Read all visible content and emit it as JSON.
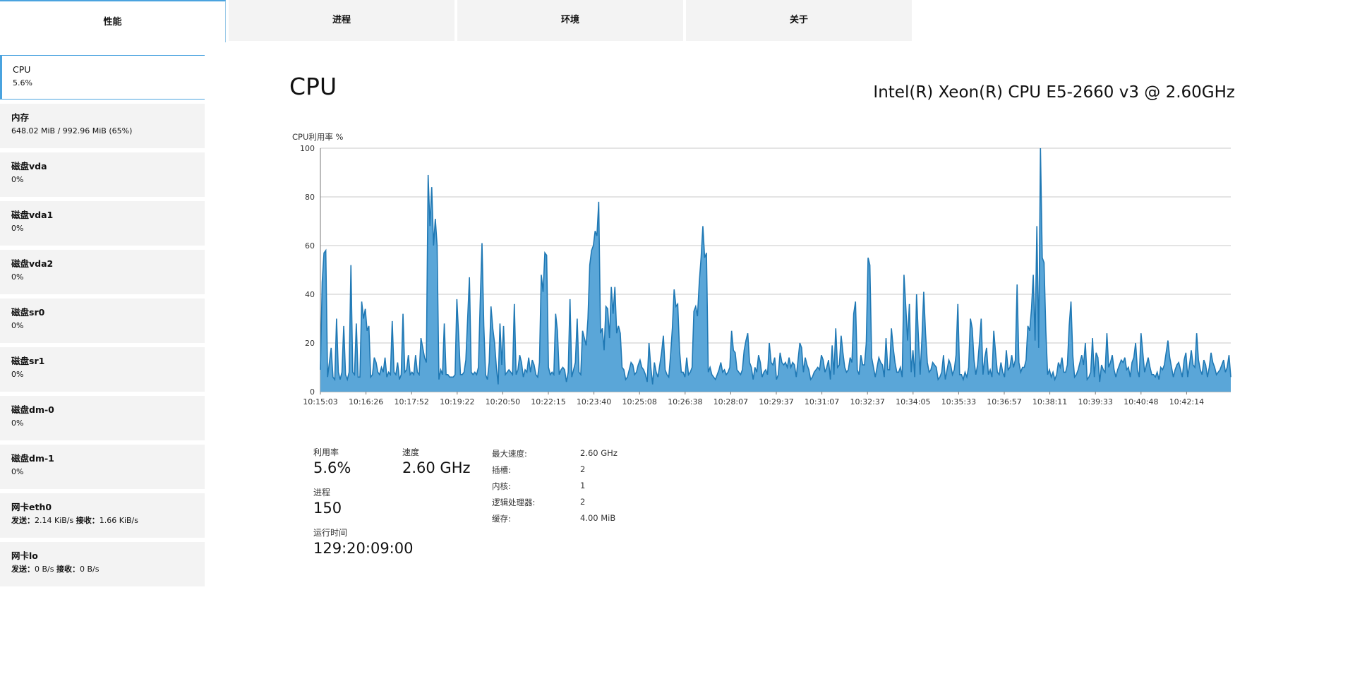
{
  "tabs": [
    {
      "label": "性能",
      "active": true
    },
    {
      "label": "进程",
      "active": false
    },
    {
      "label": "环境",
      "active": false
    },
    {
      "label": "关于",
      "active": false
    }
  ],
  "sidebar": {
    "items": [
      {
        "name": "CPU",
        "value": "5.6%",
        "active": true
      },
      {
        "name": "内存",
        "value": "648.02 MiB / 992.96 MiB (65%)"
      },
      {
        "name": "磁盘vda",
        "value": "0%"
      },
      {
        "name": "磁盘vda1",
        "value": "0%"
      },
      {
        "name": "磁盘vda2",
        "value": "0%"
      },
      {
        "name": "磁盘sr0",
        "value": "0%"
      },
      {
        "name": "磁盘sr1",
        "value": "0%"
      },
      {
        "name": "磁盘dm-0",
        "value": "0%"
      },
      {
        "name": "磁盘dm-1",
        "value": "0%"
      },
      {
        "name": "网卡eth0",
        "send_label": "发送：",
        "send": "2.14 KiB/s",
        "recv_label": "接收：",
        "recv": "1.66 KiB/s"
      },
      {
        "name": "网卡lo",
        "send_label": "发送：",
        "send": "0 B/s",
        "recv_label": "接收：",
        "recv": "0 B/s"
      }
    ]
  },
  "main": {
    "title": "CPU",
    "model": "Intel(R) Xeon(R) CPU E5-2660 v3 @ 2.60GHz"
  },
  "chart_data": {
    "type": "area",
    "ylabel": "CPU利用率 %",
    "ylim": [
      0,
      100
    ],
    "yticks": [
      0,
      20,
      40,
      60,
      80,
      100
    ],
    "xticks": [
      "10:15:03",
      "10:16:26",
      "10:17:52",
      "10:19:22",
      "10:20:50",
      "10:22:15",
      "10:23:40",
      "10:25:08",
      "10:26:38",
      "10:28:07",
      "10:29:37",
      "10:31:07",
      "10:32:37",
      "10:34:05",
      "10:35:33",
      "10:36:57",
      "10:38:11",
      "10:39:33",
      "10:40:48",
      "10:42:14"
    ],
    "color": "#1f78b4",
    "fill": "#5aa6d8",
    "values": [
      9,
      45,
      57,
      58,
      6,
      12,
      18,
      6,
      5,
      30,
      8,
      5,
      8,
      27,
      7,
      5,
      8,
      52,
      8,
      7,
      28,
      6,
      6,
      37,
      30,
      34,
      25,
      27,
      6,
      7,
      14,
      12,
      8,
      7,
      10,
      8,
      14,
      6,
      8,
      7,
      29,
      8,
      7,
      12,
      5,
      7,
      32,
      8,
      9,
      15,
      7,
      8,
      7,
      15,
      8,
      7,
      22,
      18,
      14,
      12,
      89,
      68,
      84,
      60,
      71,
      60,
      5,
      9,
      7,
      28,
      7,
      7,
      6,
      6,
      6,
      7,
      38,
      23,
      7,
      7,
      8,
      13,
      30,
      47,
      8,
      7,
      8,
      7,
      10,
      37,
      61,
      27,
      7,
      5,
      12,
      35,
      26,
      20,
      10,
      3,
      28,
      11,
      27,
      7,
      8,
      9,
      8,
      7,
      36,
      7,
      9,
      15,
      12,
      6,
      9,
      8,
      14,
      8,
      13,
      11,
      7,
      6,
      12,
      48,
      41,
      57,
      56,
      10,
      7,
      8,
      7,
      32,
      25,
      7,
      9,
      10,
      9,
      4,
      8,
      38,
      6,
      9,
      12,
      30,
      8,
      7,
      25,
      22,
      19,
      30,
      52,
      58,
      60,
      66,
      64,
      78,
      24,
      26,
      17,
      35,
      34,
      22,
      43,
      32,
      43,
      24,
      27,
      24,
      10,
      9,
      5,
      6,
      9,
      12,
      11,
      7,
      8,
      11,
      13,
      10,
      9,
      7,
      4,
      20,
      10,
      3,
      12,
      8,
      6,
      11,
      16,
      23,
      9,
      7,
      6,
      15,
      26,
      42,
      35,
      36,
      17,
      8,
      8,
      6,
      14,
      7,
      8,
      10,
      33,
      35,
      31,
      45,
      55,
      68,
      55,
      57,
      8,
      10,
      7,
      6,
      5,
      7,
      9,
      12,
      8,
      9,
      7,
      8,
      10,
      25,
      17,
      16,
      9,
      8,
      7,
      9,
      17,
      21,
      24,
      12,
      10,
      5,
      10,
      8,
      15,
      12,
      6,
      8,
      9,
      7,
      20,
      12,
      11,
      14,
      5,
      7,
      16,
      12,
      11,
      12,
      10,
      14,
      10,
      12,
      11,
      6,
      13,
      20,
      18,
      8,
      14,
      11,
      9,
      5,
      6,
      8,
      9,
      10,
      9,
      15,
      13,
      8,
      10,
      13,
      5,
      19,
      7,
      26,
      10,
      11,
      23,
      16,
      10,
      8,
      9,
      14,
      12,
      32,
      37,
      9,
      7,
      15,
      11,
      11,
      20,
      55,
      52,
      14,
      10,
      6,
      10,
      14,
      12,
      11,
      6,
      22,
      9,
      9,
      26,
      18,
      12,
      8,
      8,
      10,
      6,
      48,
      35,
      21,
      36,
      8,
      17,
      6,
      40,
      23,
      7,
      22,
      41,
      24,
      12,
      8,
      9,
      12,
      11,
      10,
      5,
      6,
      8,
      15,
      5,
      9,
      13,
      11,
      7,
      9,
      15,
      36,
      7,
      7,
      5,
      8,
      6,
      10,
      30,
      26,
      13,
      7,
      11,
      20,
      30,
      7,
      14,
      18,
      7,
      9,
      6,
      25,
      16,
      8,
      7,
      12,
      8,
      6,
      17,
      9,
      10,
      15,
      10,
      13,
      44,
      12,
      8,
      10,
      10,
      13,
      27,
      25,
      34,
      48,
      21,
      68,
      18,
      100,
      55,
      53,
      25,
      7,
      9,
      6,
      8,
      5,
      7,
      12,
      10,
      14,
      8,
      8,
      11,
      27,
      37,
      15,
      6,
      7,
      9,
      12,
      15,
      11,
      20,
      5,
      6,
      8,
      22,
      6,
      16,
      14,
      4,
      11,
      9,
      8,
      24,
      10,
      12,
      15,
      9,
      6,
      9,
      11,
      13,
      12,
      14,
      9,
      10,
      6,
      12,
      14,
      20,
      9,
      6,
      24,
      16,
      8,
      11,
      14,
      10,
      7,
      7,
      6,
      8,
      5,
      10,
      9,
      11,
      16,
      21,
      14,
      10,
      6,
      9,
      11,
      12,
      9,
      6,
      13,
      16,
      6,
      11,
      17,
      11,
      10,
      24,
      13,
      9,
      7,
      13,
      11,
      6,
      10,
      16,
      12,
      10,
      7,
      8,
      9,
      11,
      13,
      8,
      10,
      15,
      6
    ]
  },
  "stats": {
    "util_label": "利用率",
    "util": "5.6%",
    "speed_label": "速度",
    "speed": "2.60 GHz",
    "proc_label": "进程",
    "proc": "150",
    "uptime_label": "运行时间",
    "uptime": "129:20:09:00"
  },
  "specs": [
    {
      "label": "最大速度:",
      "value": "2.60 GHz"
    },
    {
      "label": "插槽:",
      "value": "2"
    },
    {
      "label": "内核:",
      "value": "1"
    },
    {
      "label": "逻辑处理器:",
      "value": "2"
    },
    {
      "label": "缓存:",
      "value": "4.00 MiB"
    }
  ]
}
